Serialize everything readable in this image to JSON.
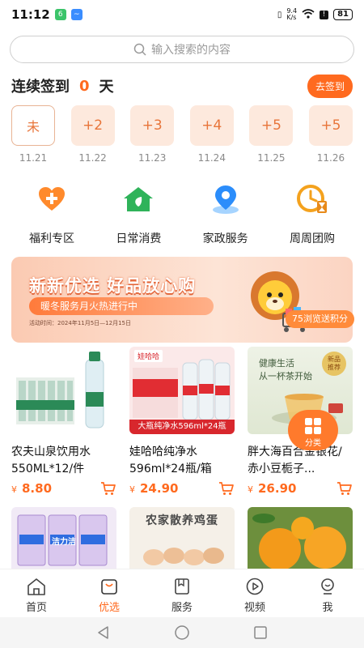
{
  "status": {
    "time": "11:12",
    "net_speed": "9.4\nK/s",
    "battery": "81"
  },
  "search": {
    "placeholder": "输入搜索的内容"
  },
  "checkin": {
    "label": "连续签到",
    "days": "0",
    "unit": "天",
    "button": "去签到"
  },
  "calendar": [
    {
      "value": "未",
      "date": "11.21",
      "active": true
    },
    {
      "value": "+2",
      "date": "11.22"
    },
    {
      "value": "+3",
      "date": "11.23"
    },
    {
      "value": "+4",
      "date": "11.24"
    },
    {
      "value": "+5",
      "date": "11.25"
    },
    {
      "value": "+5",
      "date": "11.26"
    }
  ],
  "categories": [
    {
      "label": "福利专区",
      "icon": "heart-plus-icon"
    },
    {
      "label": "日常消费",
      "icon": "house-leaf-icon"
    },
    {
      "label": "家政服务",
      "icon": "location-pin-icon"
    },
    {
      "label": "周周团购",
      "icon": "clock-hourglass-icon"
    }
  ],
  "banner": {
    "headline": "新新优选  好品放心购",
    "pill": "暖冬服务月火热进行中",
    "subtext": "活动时间：2024年11月5日—12月15日",
    "float_pill": "75浏览送积分"
  },
  "products": [
    {
      "title": "农夫山泉饮用水550ML*12/件",
      "price": "8.80"
    },
    {
      "title": "娃哈哈纯净水596ml*24瓶/箱",
      "price": "24.90",
      "img_label": "大瓶纯净水596ml*24瓶",
      "brand": "娃哈哈"
    },
    {
      "title": "胖大海百合金银花/赤小豆栀子...",
      "price": "26.90",
      "img_line1": "健康生活",
      "img_line2": "从一杯茶开始",
      "badge": "新品\n推荐"
    }
  ],
  "products_row2": [
    {
      "img_label": "洁力洁"
    },
    {
      "img_label": "农家散养鸡蛋"
    },
    {
      "img_label": ""
    }
  ],
  "currency": "¥",
  "fab": {
    "label": "分类"
  },
  "tabs": [
    {
      "label": "首页",
      "icon": "home-icon"
    },
    {
      "label": "优选",
      "icon": "bag-icon",
      "active": true
    },
    {
      "label": "服务",
      "icon": "bookmark-icon"
    },
    {
      "label": "视频",
      "icon": "play-icon"
    },
    {
      "label": "我",
      "icon": "person-icon"
    }
  ],
  "colors": {
    "accent": "#ff6a1f",
    "soft": "#fde9dd"
  }
}
